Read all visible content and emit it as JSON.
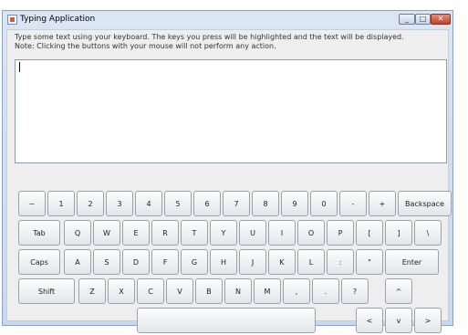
{
  "window": {
    "title": "Typing Application",
    "minimize_symbol": "_",
    "maximize_symbol": "□",
    "close_symbol": "✕"
  },
  "instructions": {
    "line1": "Type some text using your keyboard.  The keys you press will be highlighted and the text will be displayed.",
    "line2": "Note: Clicking the buttons with your mouse will not perform any action."
  },
  "text_area": {
    "value": ""
  },
  "keyboard": {
    "row1": [
      "~",
      "1",
      "2",
      "3",
      "4",
      "5",
      "6",
      "7",
      "8",
      "9",
      "0",
      "-",
      "+",
      "Backspace"
    ],
    "row2": [
      "Tab",
      "Q",
      "W",
      "E",
      "R",
      "T",
      "Y",
      "U",
      "I",
      "O",
      "P",
      "[",
      "]",
      "\\"
    ],
    "row3": [
      "Caps",
      "A",
      "S",
      "D",
      "F",
      "G",
      "H",
      "J",
      "K",
      "L",
      ":",
      "\"",
      "Enter"
    ],
    "row4": [
      "Shift",
      "Z",
      "X",
      "C",
      "V",
      "B",
      "N",
      "M",
      ",",
      ".",
      "?",
      "^"
    ],
    "row5": [
      "",
      "<",
      "v",
      ">"
    ]
  },
  "colors": {
    "window_border": "#8aa3c4",
    "panel_background": "#eeeeee",
    "close_button": "#c2412c"
  },
  "icons": {
    "app": "java-app-icon",
    "minimize": "minimize-icon",
    "maximize": "maximize-icon",
    "close": "close-icon"
  }
}
